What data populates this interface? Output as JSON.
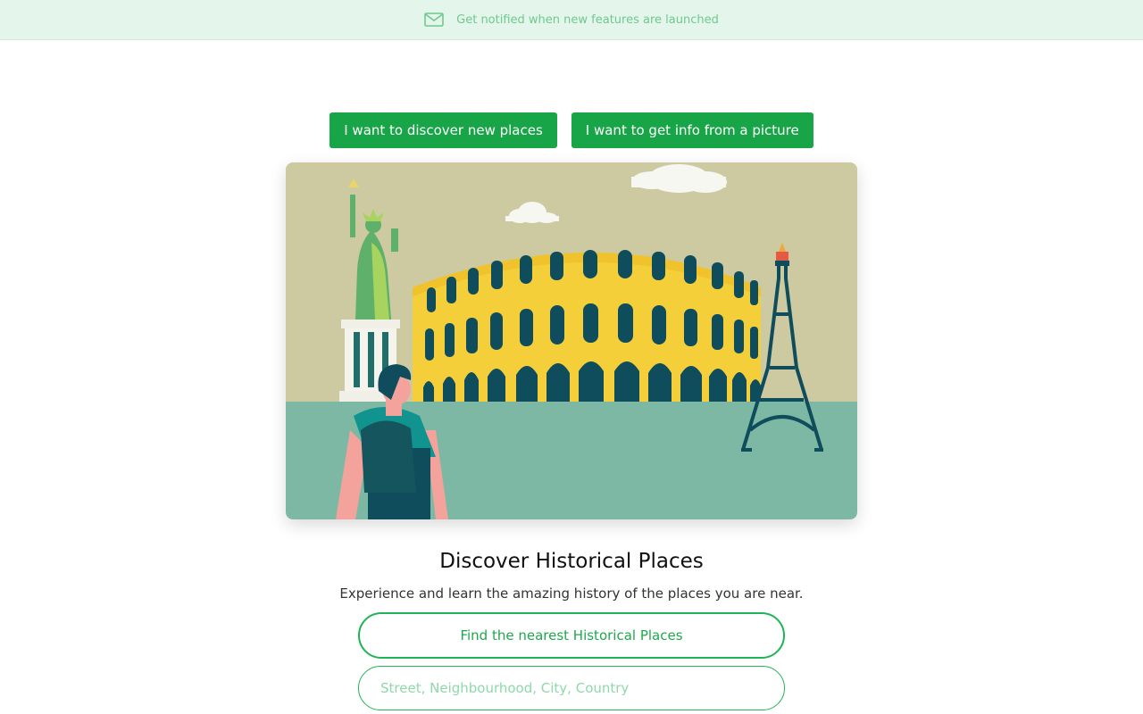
{
  "banner": {
    "icon": "mail-icon",
    "text": "Get notified when new features are launched"
  },
  "tabs": [
    {
      "label": "I want to discover new places"
    },
    {
      "label": "I want to get info from a picture"
    }
  ],
  "hero": {
    "illustration": "travel-landmarks-illustration",
    "subjects": [
      "statue-of-liberty",
      "colosseum",
      "eiffel-tower",
      "traveler-with-backpack"
    ]
  },
  "main": {
    "title": "Discover Historical Places",
    "subtitle": "Experience and learn the amazing history of the places you are near.",
    "find_button": "Find the nearest Historical Places",
    "address_placeholder": "Street, Neighbourhood, City, Country",
    "address_value": ""
  },
  "colors": {
    "accent": "#18a548",
    "banner_bg": "#e4f5ec",
    "banner_text": "#6fc98f"
  }
}
